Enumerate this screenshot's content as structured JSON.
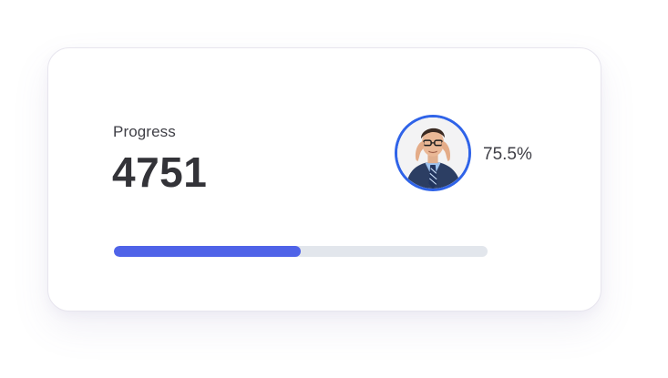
{
  "card": {
    "label": "Progress",
    "value": "4751",
    "percent_text": "75.5%"
  },
  "progress_bar": {
    "fill_fraction": 0.5
  },
  "colors": {
    "accent": "#4f63e8",
    "avatar_ring": "#2f63e8",
    "track": "#e2e6ec",
    "text": "#333338"
  },
  "icons": {
    "avatar": "person-avatar-photo"
  }
}
